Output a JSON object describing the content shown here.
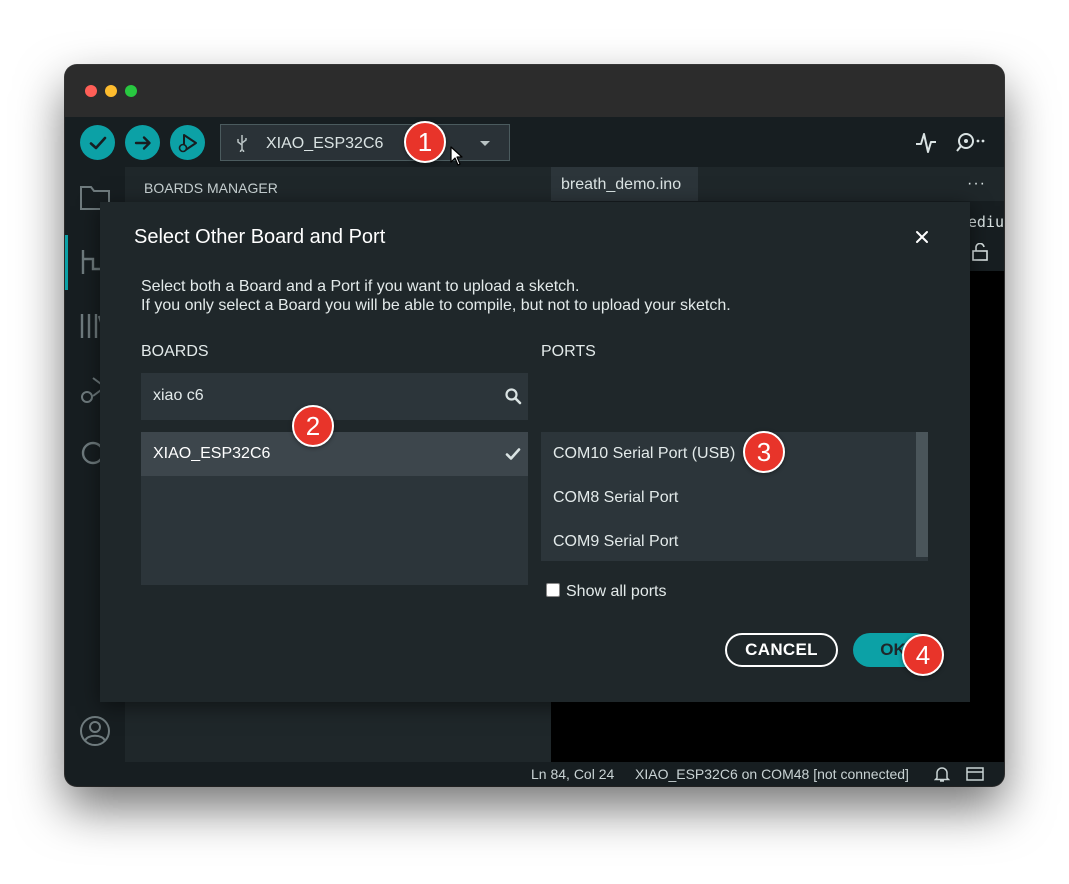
{
  "toolbar": {
    "board_label": "XIAO_ESP32C6"
  },
  "panel": {
    "title": "BOARDS MANAGER"
  },
  "editor": {
    "file_tab": "breath_demo.ino",
    "more": "···",
    "partial_text": "ediu"
  },
  "statusbar": {
    "position": "Ln 84, Col 24",
    "board_status": "XIAO_ESP32C6 on COM48 [not connected]"
  },
  "dialog": {
    "title": "Select Other Board and Port",
    "desc_line1": "Select both a Board and a Port if you want to upload a sketch.",
    "desc_line2": "If you only select a Board you will be able to compile, but not to upload your sketch.",
    "boards_label": "BOARDS",
    "ports_label": "PORTS",
    "search_value": "xiao c6",
    "boards": [
      "XIAO_ESP32C6"
    ],
    "ports": [
      "COM10 Serial Port (USB)",
      "COM8 Serial Port",
      "COM9 Serial Port"
    ],
    "show_all_label": "Show all ports",
    "show_all_checked": false,
    "cancel_label": "CANCEL",
    "ok_label": "OK"
  },
  "badges": [
    "1",
    "2",
    "3",
    "4"
  ],
  "colors": {
    "accent": "#0ca1a6",
    "badge": "#e8342a",
    "background": "#171e21",
    "dialog": "#1f272a"
  }
}
